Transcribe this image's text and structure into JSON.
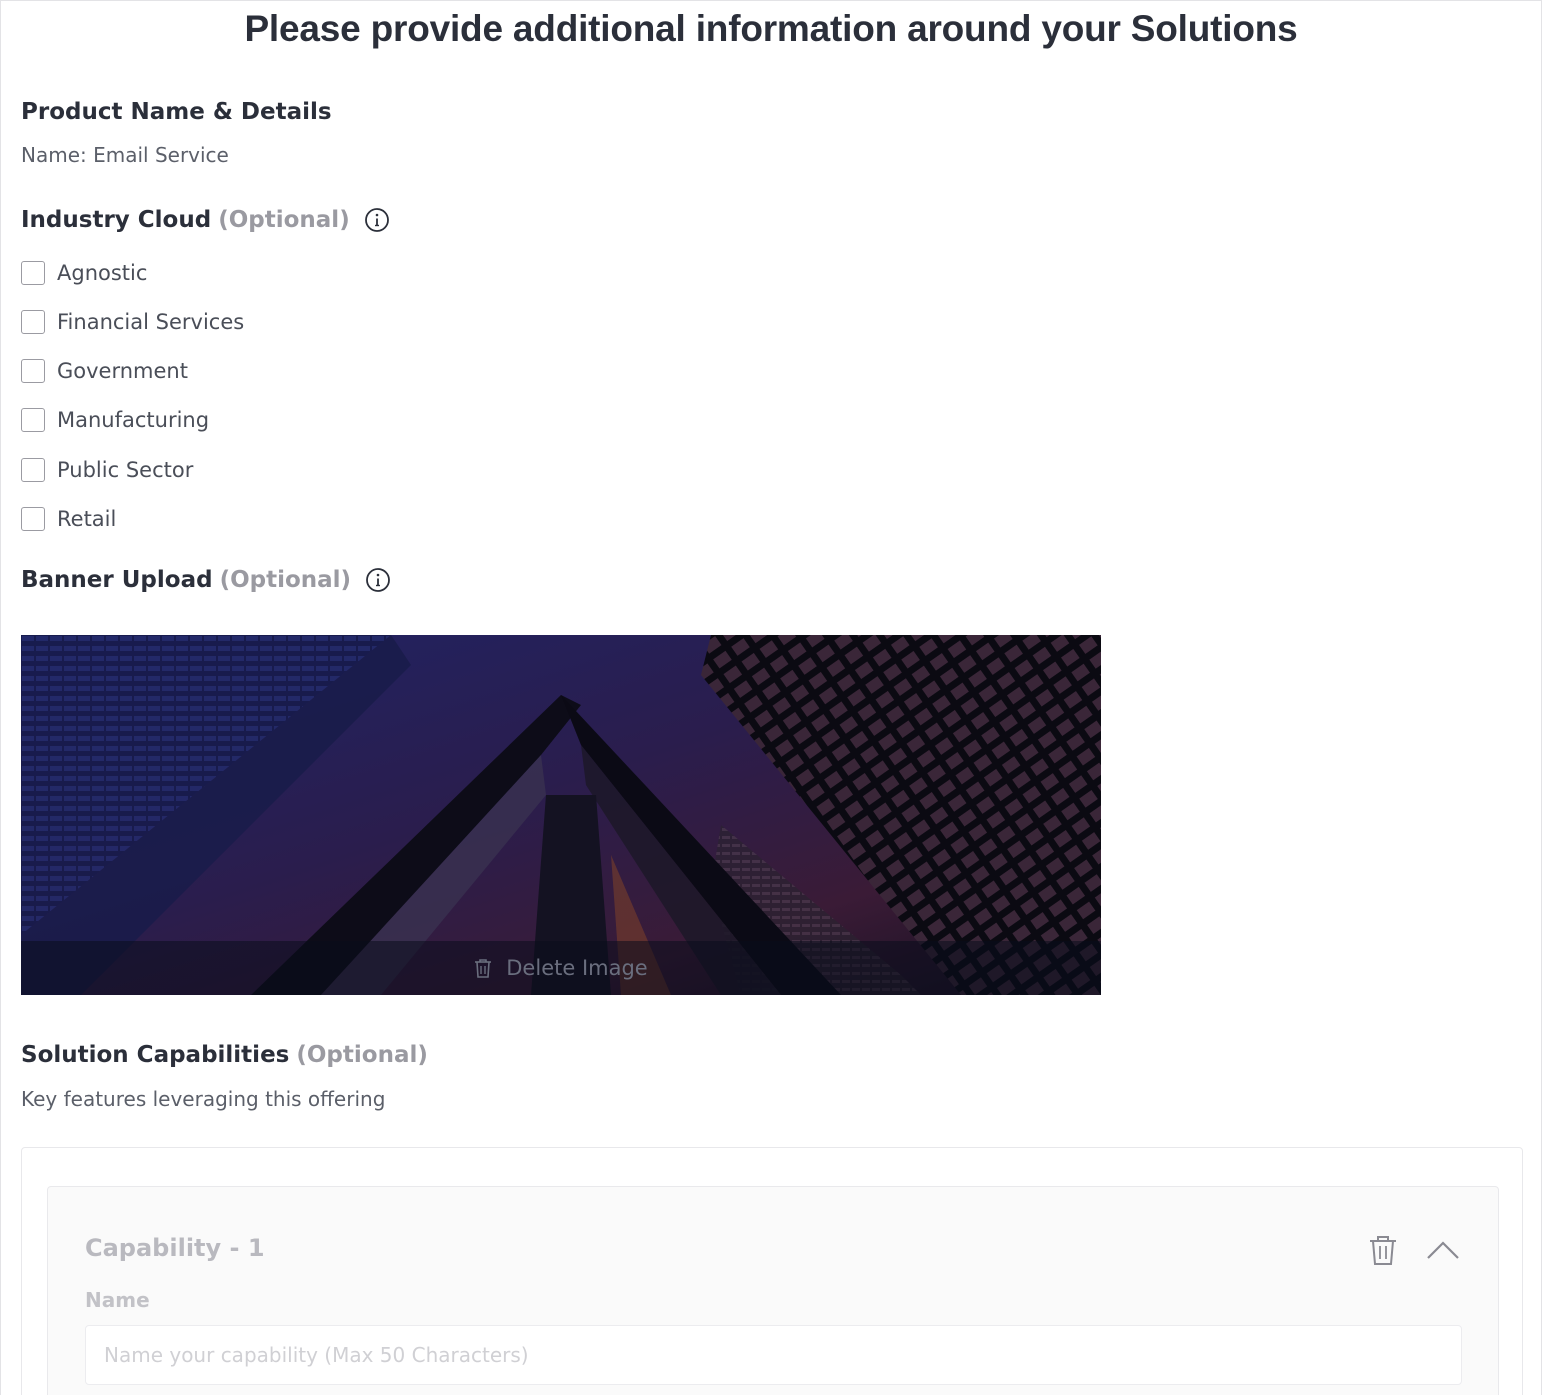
{
  "page": {
    "title": "Please provide additional information around your Solutions"
  },
  "product": {
    "heading": "Product Name & Details",
    "name_line": "Name: Email Service"
  },
  "industry_cloud": {
    "heading": "Industry Cloud",
    "optional_label": "(Optional)",
    "info_icon": "info-icon",
    "options": [
      {
        "label": "Agnostic",
        "checked": false
      },
      {
        "label": "Financial Services",
        "checked": false
      },
      {
        "label": "Government",
        "checked": false
      },
      {
        "label": "Manufacturing",
        "checked": false
      },
      {
        "label": "Public Sector",
        "checked": false
      },
      {
        "label": "Retail",
        "checked": false
      }
    ]
  },
  "banner_upload": {
    "heading": "Banner Upload",
    "optional_label": "(Optional)",
    "info_icon": "info-icon",
    "delete_label": "Delete Image",
    "delete_icon": "trash-icon"
  },
  "solution_capabilities": {
    "heading": "Solution Capabilities",
    "optional_label": "(Optional)",
    "description": "Key features leveraging this offering",
    "capabilities": [
      {
        "title": "Capability - 1",
        "name_label": "Name",
        "name_placeholder": "Name your capability (Max 50 Characters)",
        "name_value": "",
        "delete_icon": "trash-icon",
        "collapse_icon": "chevron-up-icon"
      }
    ]
  },
  "colors": {
    "text_primary": "#2b2f3a",
    "text_muted": "#9a9aa1",
    "border": "#e3e3e6"
  }
}
